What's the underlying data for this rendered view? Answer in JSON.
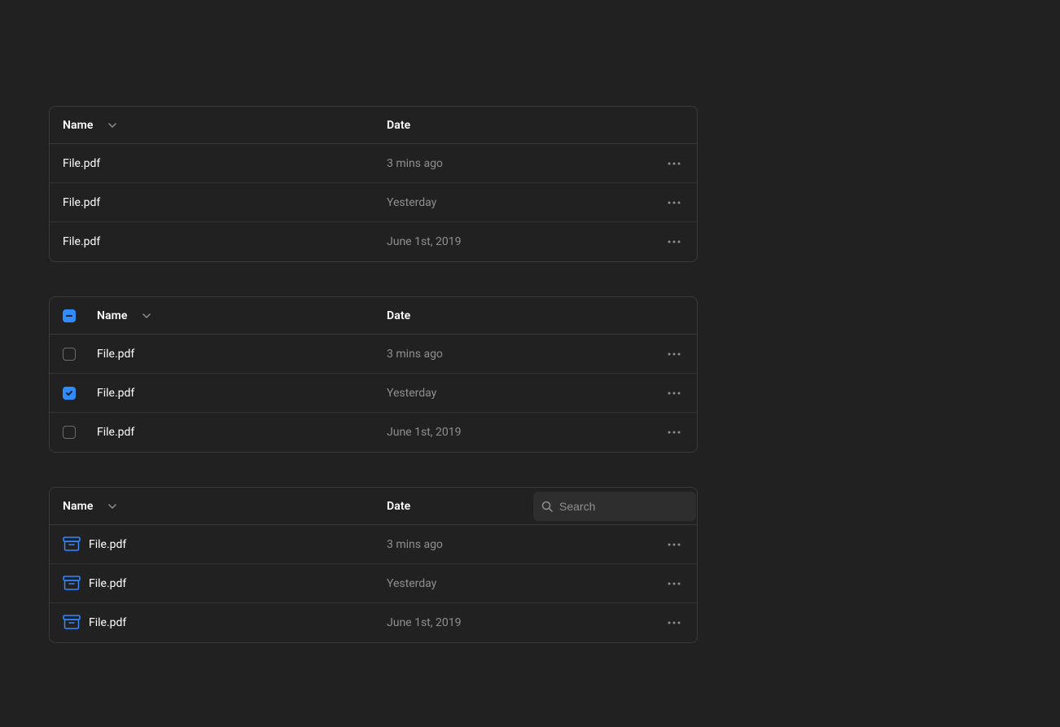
{
  "headers": {
    "name": "Name",
    "date": "Date"
  },
  "search": {
    "placeholder": "Search"
  },
  "table1": {
    "rows": [
      {
        "name": "File.pdf",
        "date": "3 mins ago"
      },
      {
        "name": "File.pdf",
        "date": "Yesterday"
      },
      {
        "name": "File.pdf",
        "date": "June 1st, 2019"
      }
    ]
  },
  "table2": {
    "header_checkbox": "indeterminate",
    "rows": [
      {
        "name": "File.pdf",
        "date": "3 mins ago",
        "checked": false
      },
      {
        "name": "File.pdf",
        "date": "Yesterday",
        "checked": true
      },
      {
        "name": "File.pdf",
        "date": "June 1st, 2019",
        "checked": false
      }
    ]
  },
  "table3": {
    "rows": [
      {
        "name": "File.pdf",
        "date": "3 mins ago"
      },
      {
        "name": "File.pdf",
        "date": "Yesterday"
      },
      {
        "name": "File.pdf",
        "date": "June 1st, 2019"
      }
    ]
  }
}
